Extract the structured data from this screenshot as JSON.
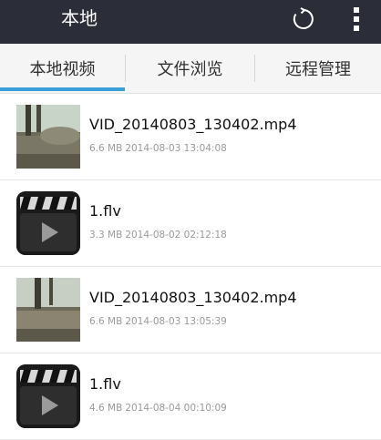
{
  "header": {
    "title": "本地"
  },
  "tabs": [
    {
      "label": "本地视频"
    },
    {
      "label": "文件浏览"
    },
    {
      "label": "远程管理"
    }
  ],
  "files": [
    {
      "name": "VID_20140803_130402.mp4",
      "size": "6.6 MB",
      "date": "2014-08-03 13:04:08",
      "thumb": "video"
    },
    {
      "name": "1.flv",
      "size": "3.3 MB",
      "date": "2014-08-02 02:12:18",
      "thumb": "clapperboard"
    },
    {
      "name": "VID_20140803_130402.mp4",
      "size": "6.6 MB",
      "date": "2014-08-03 13:05:39",
      "thumb": "video"
    },
    {
      "name": "1.flv",
      "size": "4.6 MB",
      "date": "2014-08-04 00:10:09",
      "thumb": "clapperboard"
    }
  ],
  "colors": {
    "topbar": "#2b2d38",
    "tab_indicator": "#3a9ed8",
    "meta_text": "#9a9a9a"
  }
}
